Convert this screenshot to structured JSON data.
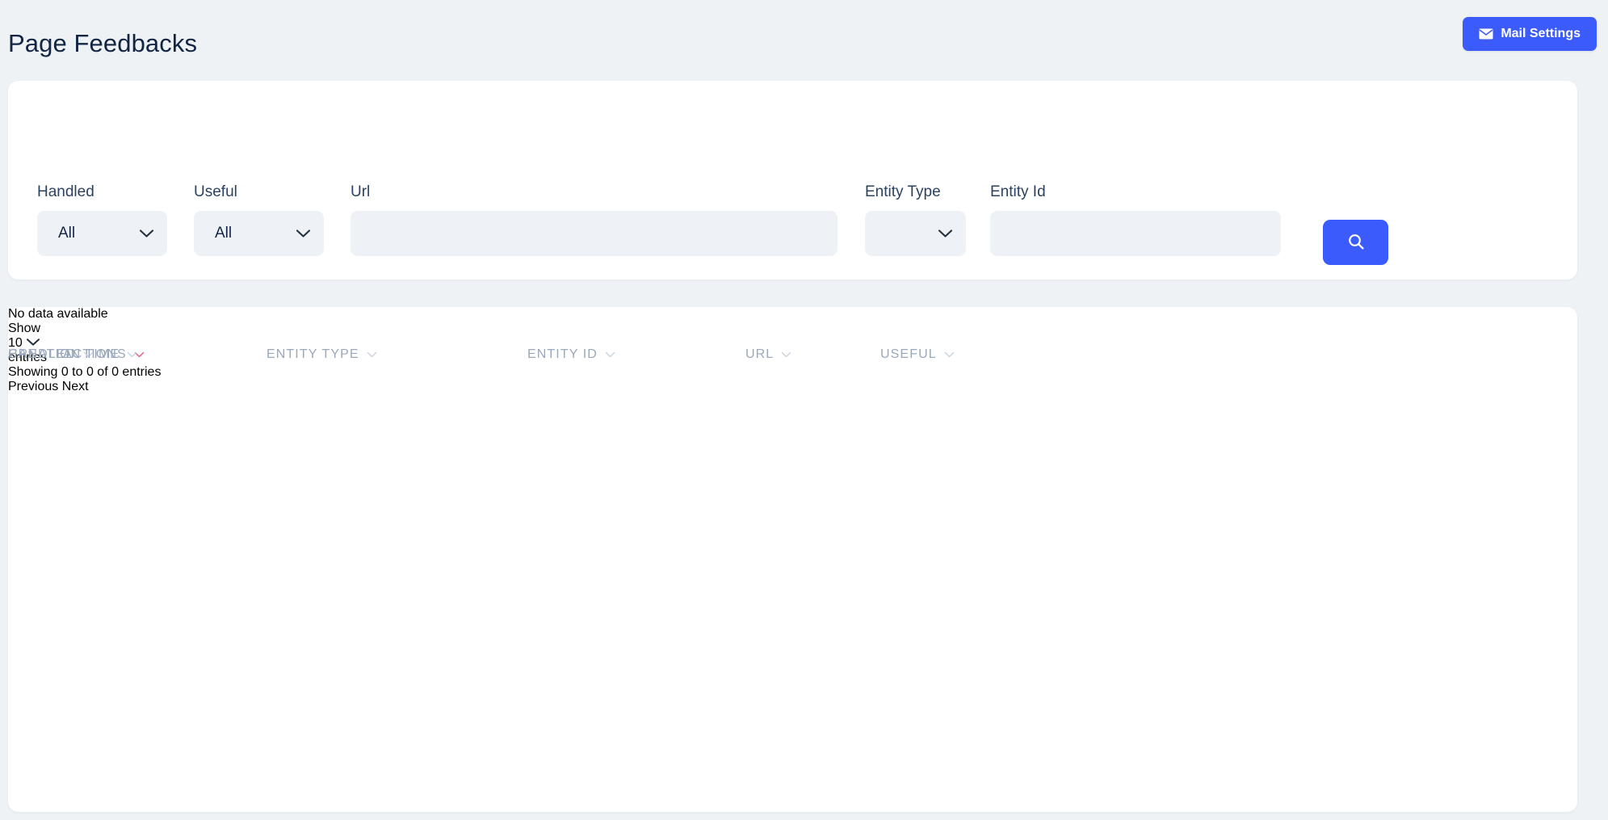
{
  "header": {
    "title": "Page Feedbacks",
    "mail_settings_label": "Mail Settings",
    "mail_icon": "envelope-icon",
    "accent_color": "#3b5bfd"
  },
  "filters": {
    "handled": {
      "label": "Handled",
      "value": "All"
    },
    "useful": {
      "label": "Useful",
      "value": "All"
    },
    "url": {
      "label": "Url",
      "value": "",
      "placeholder": ""
    },
    "entity_type": {
      "label": "Entity Type",
      "value": ""
    },
    "entity_id": {
      "label": "Entity Id",
      "value": "",
      "placeholder": ""
    },
    "search_icon": "search-icon"
  },
  "table": {
    "columns": [
      {
        "label": "ACTIONS",
        "sort_icon": "chevron-down-icon",
        "sort_icon_color": "#e8648c"
      },
      {
        "label": "ENTITY TYPE",
        "sort_icon": "chevron-down-icon",
        "sort_icon_color": "#ccd5e0"
      },
      {
        "label": "ENTITY ID",
        "sort_icon": "chevron-down-icon",
        "sort_icon_color": "#ccd5e0"
      },
      {
        "label": "URL",
        "sort_icon": "chevron-down-icon",
        "sort_icon_color": "#ccd5e0"
      },
      {
        "label": "USEFUL",
        "sort_icon": "chevron-down-icon",
        "sort_icon_color": "#ccd5e0"
      },
      {
        "label": "HANDLED",
        "sort_icon": "chevron-down-icon",
        "sort_icon_color": "#ccd5e0"
      },
      {
        "label": "CREATION TIME",
        "sort_icon": "chevron-down-icon",
        "sort_icon_color": "#ccd5e0"
      }
    ],
    "rows": [],
    "empty_message": "No data available"
  },
  "footer": {
    "show_label": "Show",
    "entries_label": "entries",
    "page_size": "10",
    "showing_info": "Showing 0 to 0 of 0 entries",
    "previous_label": "Previous",
    "next_label": "Next"
  }
}
